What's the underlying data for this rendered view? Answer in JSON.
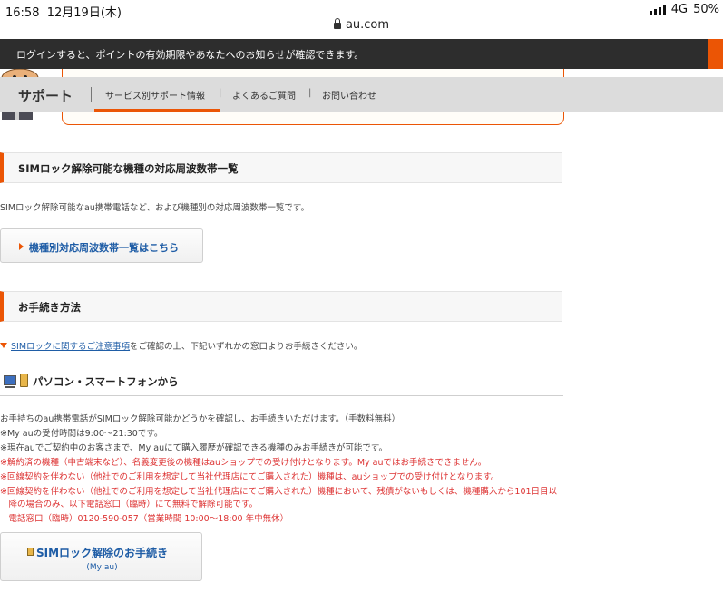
{
  "status": {
    "time": "16:58",
    "date": "12月19日(木)",
    "network": "4G",
    "battery": "50%"
  },
  "url": "au.com",
  "login_banner": {
    "message": "ログインすると、ポイントの有効期限やあなたへのお知らせが確認できます。"
  },
  "support_nav": {
    "title": "サポート",
    "items": [
      "サービス別サポート情報",
      "よくあるご質問",
      "お問い合わせ"
    ],
    "active": "サービス別サポート情報"
  },
  "section1": {
    "heading": "SIMロック解除可能な機種の対応周波数帯一覧",
    "text": "SIMロック解除可能なau携帯電話など、および機種別の対応周波数帯一覧です。",
    "button": "機種別対応周波数帯一覧はこちら"
  },
  "section2": {
    "heading": "お手続き方法",
    "notice_link": "SIMロックに関するご注意事項",
    "notice_text": "をご確認の上、下記いずれかの窓口よりお手続きください。",
    "subheading": "パソコン・スマートフォンから",
    "lines": [
      {
        "text": "お手持ちのau携帯電話がSIMロック解除可能かどうかを確認し、お手続きいただけます。（手数料無料）",
        "color": "normal"
      },
      {
        "text": "※My auの受付時間は9:00〜21:30です。",
        "color": "normal"
      },
      {
        "text": "※現在auでご契約中のお客さまで、My auにて購入履歴が確認できる機種のみお手続きが可能です。",
        "color": "normal"
      },
      {
        "text": "※解約済の機種（中古端末など）、名義変更後の機種はauショップでの受け付けとなります。My auではお手続きできません。",
        "color": "red"
      },
      {
        "text": "※回線契約を伴わない（他社でのご利用を想定して当社代理店にてご購入された）機種は、auショップでの受け付けとなります。",
        "color": "red"
      },
      {
        "text": "※回線契約を伴わない（他社でのご利用を想定して当社代理店にてご購入された）機種において、残債がないもしくは、機種購入から101日目以",
        "color": "red"
      },
      {
        "text": "　降の場合のみ、以下電話窓口（臨時）にて無料で解除可能です。",
        "color": "red"
      },
      {
        "text": "　電話窓口（臨時）0120-590-057（営業時間 10:00〜18:00 年中無休）",
        "color": "red"
      }
    ],
    "button": "SIMロック解除のお手続き",
    "button_sub": "(My au)"
  },
  "colors": {
    "accent": "#eb5505",
    "link": "#1f5da6",
    "warning": "#dd3333",
    "banner": "#2d2d2d"
  }
}
